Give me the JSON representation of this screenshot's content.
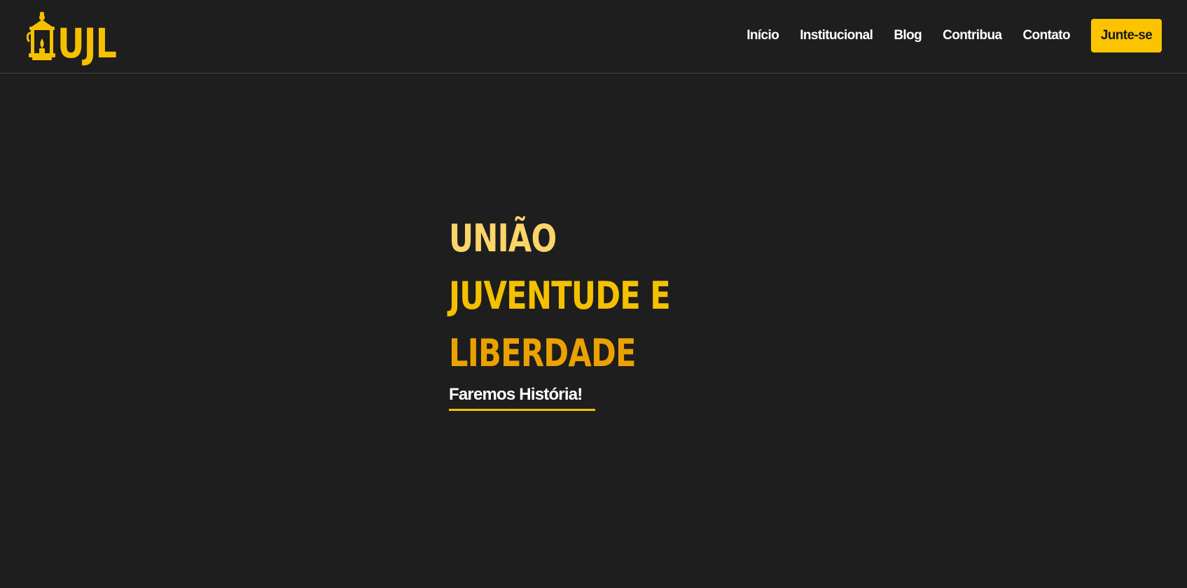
{
  "brand": {
    "logo_text": "UJL",
    "logo_icon": "lantern-icon",
    "colors": {
      "background": "#1e1e1e",
      "accent": "#f5c000",
      "button": "#fcc400"
    }
  },
  "nav": {
    "items": [
      {
        "label": "Início"
      },
      {
        "label": "Institucional"
      },
      {
        "label": "Blog"
      },
      {
        "label": "Contribua"
      },
      {
        "label": "Contato"
      }
    ],
    "cta_label": "Junte-se"
  },
  "hero": {
    "lines": [
      "UNIÃO",
      "JUVENTUDE E",
      "LIBERDADE"
    ],
    "tagline": "Faremos História!"
  }
}
